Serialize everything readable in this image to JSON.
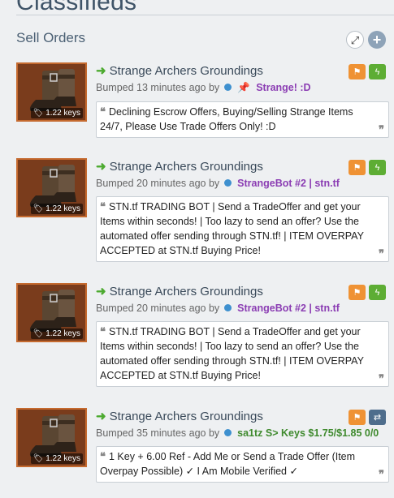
{
  "page": {
    "title": "Classifieds"
  },
  "section": {
    "title": "Sell Orders"
  },
  "controls": {
    "expand_glyph": "⤢",
    "add_glyph": "+"
  },
  "orders": [
    {
      "item_name": "Strange Archers Groundings",
      "price": "1.22 keys",
      "bumped": "Bumped 13 minutes ago by",
      "user": "Strange! :D",
      "user_color": "#8b3db3",
      "pin_icon": true,
      "second_action": "bolt",
      "message": "Declining Escrow Offers, Buying/Selling Strange Items 24/7, Please Use Trade Offers Only! :D"
    },
    {
      "item_name": "Strange Archers Groundings",
      "price": "1.22 keys",
      "bumped": "Bumped 20 minutes ago by",
      "user": "StrangeBot #2 | stn.tf",
      "user_color": "#8b3db3",
      "pin_icon": false,
      "second_action": "bolt",
      "message": "STN.tf TRADING BOT | Send a TradeOffer and get your Items within seconds! | Too lazy to send an offer? Use the automated offer sending through STN.tf! | ITEM OVERPAY ACCEPTED at STN.tf Buying Price!"
    },
    {
      "item_name": "Strange Archers Groundings",
      "price": "1.22 keys",
      "bumped": "Bumped 20 minutes ago by",
      "user": "StrangeBot #2 | stn.tf",
      "user_color": "#8b3db3",
      "pin_icon": false,
      "second_action": "bolt",
      "message": "STN.tf TRADING BOT | Send a TradeOffer and get your Items within seconds! | Too lazy to send an offer? Use the automated offer sending through STN.tf! | ITEM OVERPAY ACCEPTED at STN.tf Buying Price!"
    },
    {
      "item_name": "Strange Archers Groundings",
      "price": "1.22 keys",
      "bumped": "Bumped 35 minutes ago by",
      "user": "sa1tz S> Keys $1.75/$1.85 0/0",
      "user_color": "#3f8a2e",
      "pin_icon": false,
      "second_action": "swap",
      "message": "1 Key + 6.00 Ref - Add Me or Send a Trade Offer (Item Overpay Possible) ✓ I Am Mobile Verified ✓"
    }
  ]
}
